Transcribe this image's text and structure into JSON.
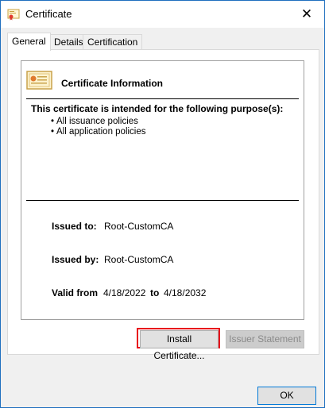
{
  "window": {
    "title": "Certificate",
    "title_icon": "certificate-icon",
    "close_glyph": "✕"
  },
  "tabs": [
    {
      "label": "General",
      "active": true
    },
    {
      "label": "Details",
      "active": false
    },
    {
      "label": "Certification Path",
      "active": false
    }
  ],
  "info": {
    "heading": "Certificate Information",
    "purpose_heading": "This certificate is intended for the following purpose(s):",
    "purposes": [
      "All issuance policies",
      "All application policies"
    ],
    "issued_to_label": "Issued to:",
    "issued_to": "Root-CustomCA",
    "issued_by_label": "Issued by:",
    "issued_by": "Root-CustomCA",
    "valid_from_label": "Valid from",
    "valid_from": "4/18/2022",
    "to_label": "to",
    "valid_to": "4/18/2032"
  },
  "buttons": {
    "install": "Install Certificate...",
    "issuer": "Issuer Statement",
    "ok": "OK"
  },
  "colors": {
    "highlight": "#e8111c",
    "focus": "#0078d7"
  }
}
